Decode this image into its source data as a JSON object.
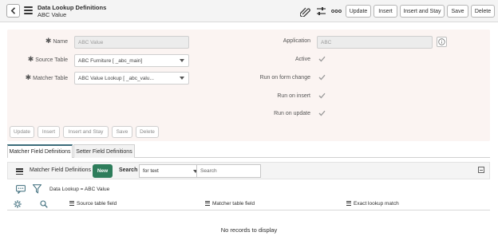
{
  "header": {
    "title": "Data Lookup Definitions",
    "subtitle": "ABC Value",
    "buttons": {
      "update": "Update",
      "insert": "Insert",
      "insert_and_stay": "Insert and Stay",
      "save": "Save",
      "delete": "Delete"
    }
  },
  "form": {
    "name": {
      "label": "Name",
      "value": "ABC Value"
    },
    "source_table": {
      "label": "Source Table",
      "value": "ABC Furniture [ _abc_main]"
    },
    "matcher_table": {
      "label": "Matcher Table",
      "value": "ABC Value Lookup [ _abc_valu..."
    },
    "application": {
      "label": "Application",
      "value": "ABC"
    },
    "active": {
      "label": "Active",
      "checked": true
    },
    "run_on_form_change": {
      "label": "Run on form change",
      "checked": true
    },
    "run_on_insert": {
      "label": "Run on insert",
      "checked": true
    },
    "run_on_update": {
      "label": "Run on update",
      "checked": true
    },
    "buttons": {
      "update": "Update",
      "insert": "Insert",
      "insert_and_stay": "Insert and Stay",
      "save": "Save",
      "delete": "Delete"
    }
  },
  "tabs": [
    {
      "label": "Matcher Field Definitions",
      "active": true
    },
    {
      "label": "Setter Field Definitions",
      "active": false
    }
  ],
  "related_list": {
    "title": "Matcher Field Definitions",
    "new_label": "New",
    "search_label": "Search",
    "search_field": "for text",
    "search_placeholder": "Search",
    "filter_breadcrumb": "Data Lookup = ABC Value",
    "columns": [
      "Source table field",
      "Matcher table field",
      "Exact lookup match"
    ],
    "empty_message": "No records to display"
  },
  "colors": {
    "accent_green": "#2e7d5b",
    "form_bg": "#fbf4f2",
    "tab_accent": "#3b6b7a"
  }
}
